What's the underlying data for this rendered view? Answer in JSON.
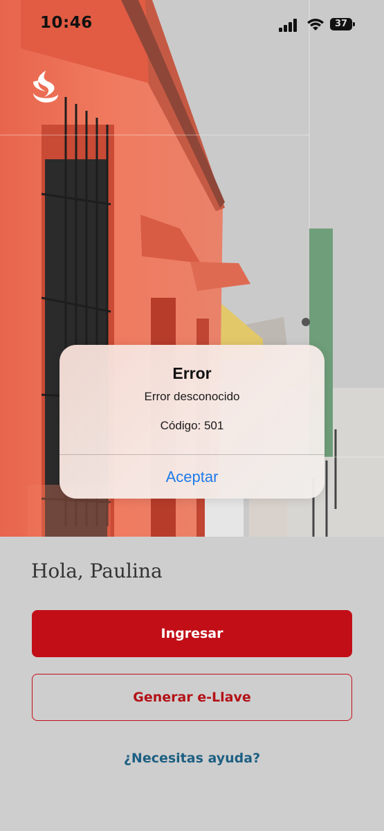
{
  "status_bar": {
    "time": "10:46",
    "battery": "37"
  },
  "dialog": {
    "title": "Error",
    "message": "Error desconocido",
    "code": "Código: 501",
    "accept_label": "Aceptar"
  },
  "main": {
    "greeting": "Hola, Paulina",
    "login_label": "Ingresar",
    "generate_key_label": "Generar e-Llave",
    "help_label": "¿Necesitas ayuda?"
  },
  "colors": {
    "brand_red": "#c20e17",
    "link_blue": "#1d5f82",
    "dialog_button_blue": "#1e7ae8"
  },
  "icons": {
    "logo": "santander-flame-logo",
    "signal": "cellular-signal-icon",
    "wifi": "wifi-icon",
    "battery": "battery-icon"
  }
}
